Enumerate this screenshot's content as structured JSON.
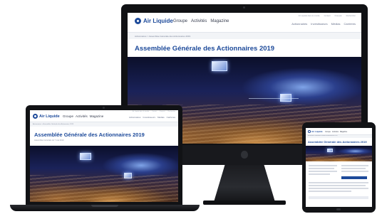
{
  "brand": {
    "logo_text": "Air Liquide",
    "colors": {
      "brand_blue": "#1d4a9a",
      "brand_red": "#d52b1e",
      "bezel": "#101114"
    }
  },
  "nav": {
    "primary": [
      "Groupe",
      "Activités",
      "Magazine"
    ],
    "secondary": [
      "Actionnaires",
      "Investisseurs",
      "Médias",
      "Carrières"
    ],
    "utility": [
      "Air Liquide dans le monde",
      "Contact",
      "Français",
      "Rechercher"
    ]
  },
  "breadcrumb": "Actionnaires > Assemblée Générale des Actionnaires 2019",
  "page": {
    "title": "Assemblée Générale des Actionnaires 2019",
    "subtitle": "Assemblée Générale du 7 mai 2019"
  },
  "hero": {
    "alt": "Auditorium de l'Assemblée Générale"
  }
}
